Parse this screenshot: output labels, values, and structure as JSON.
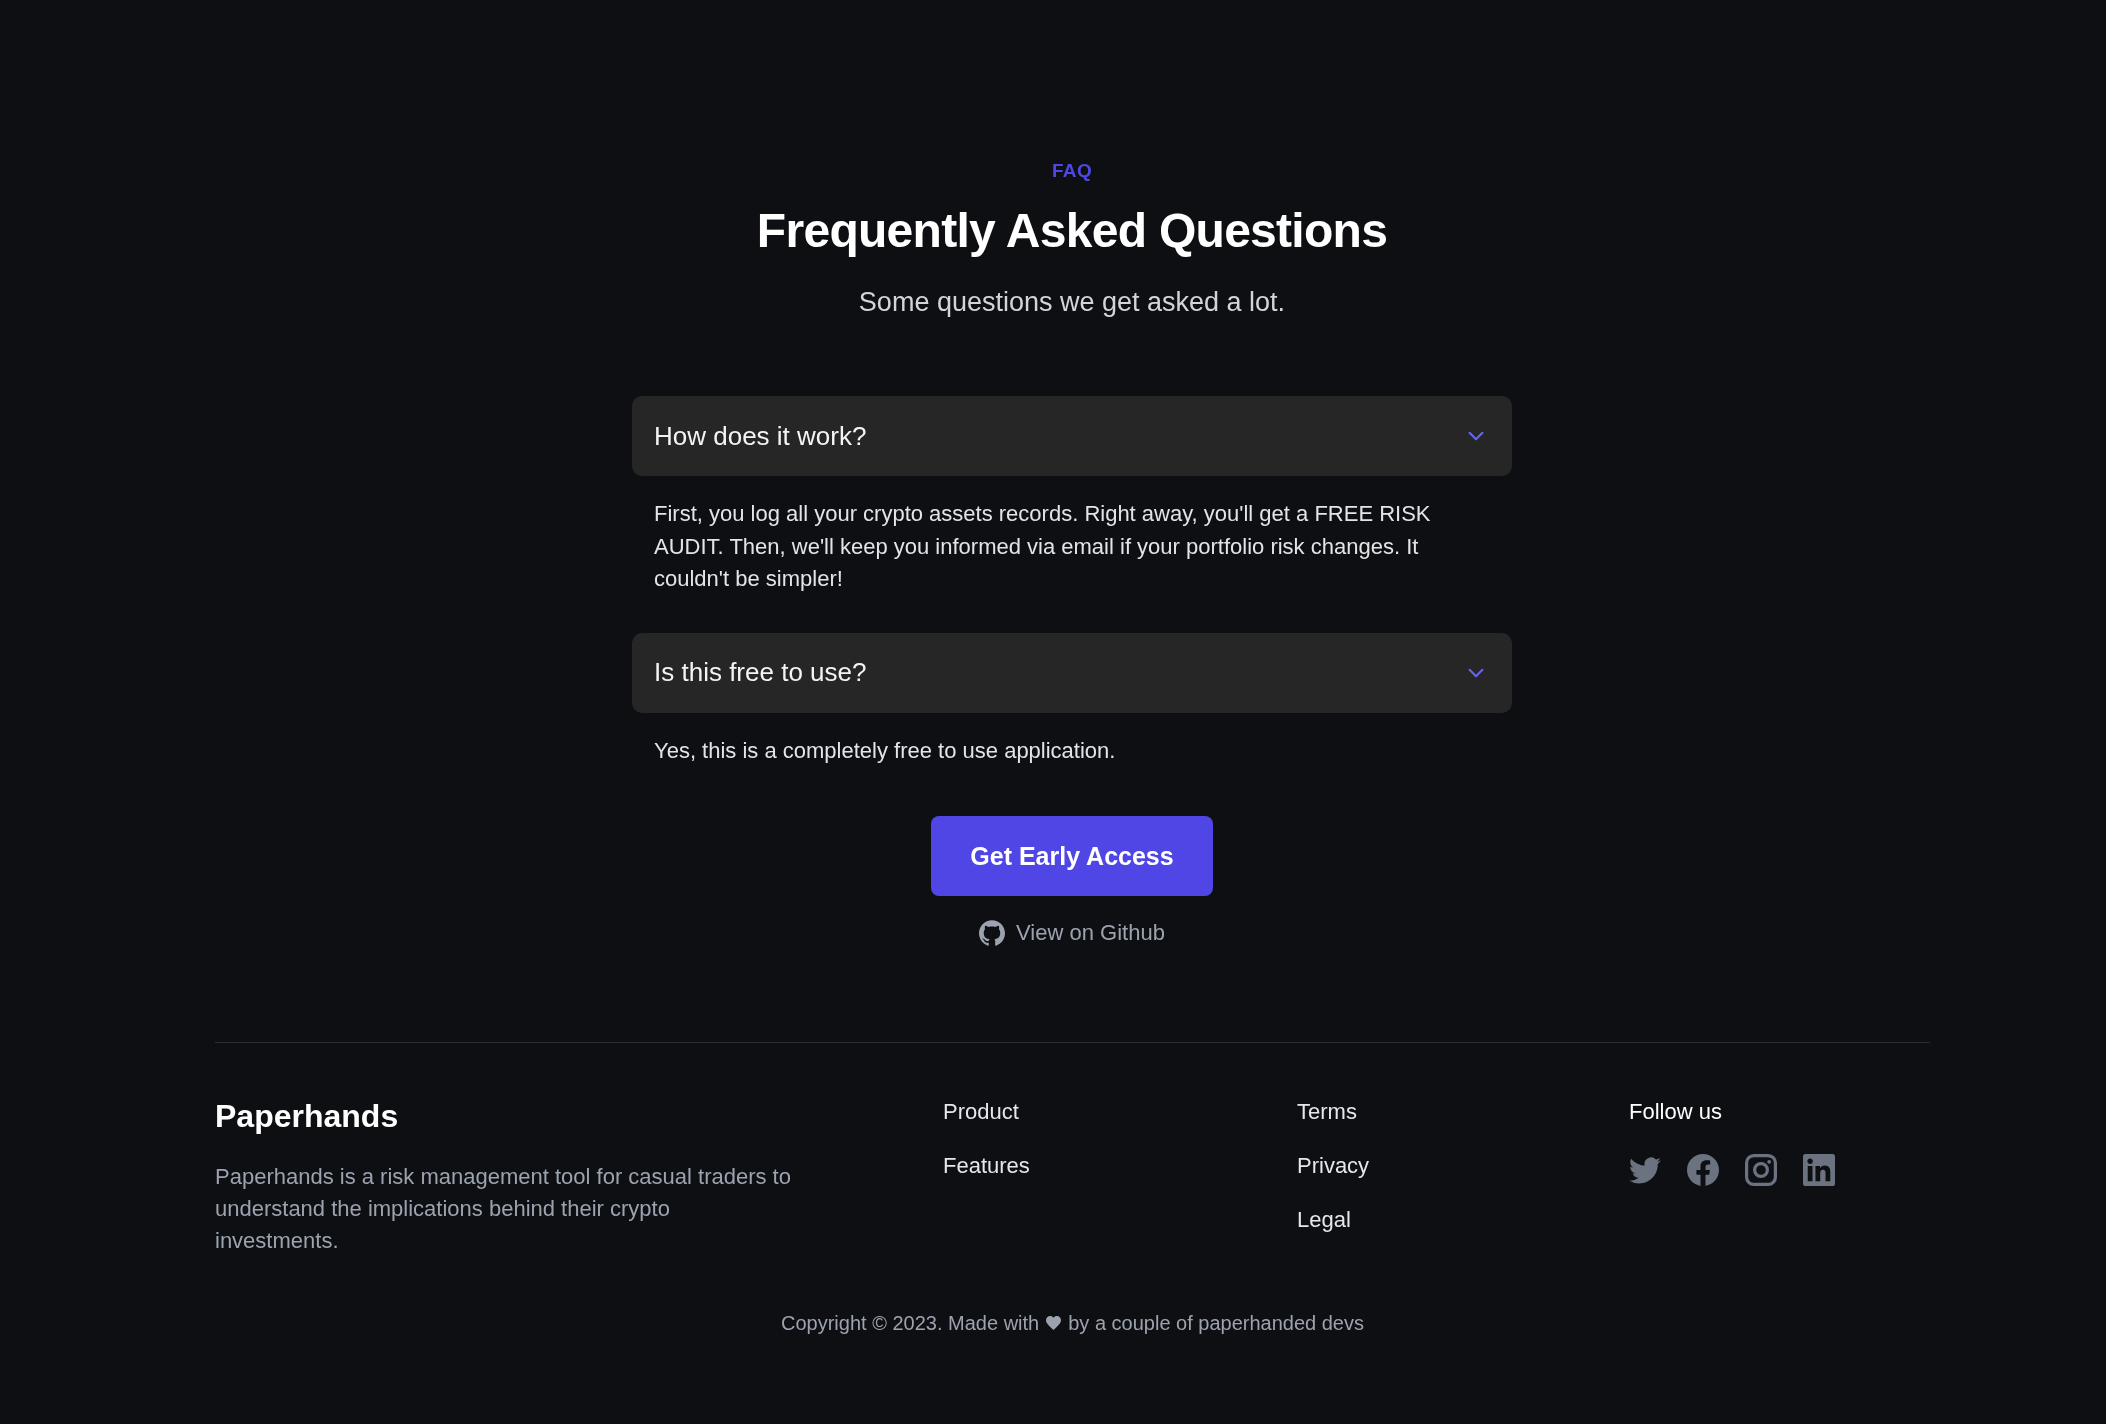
{
  "faq": {
    "eyebrow": "FAQ",
    "title": "Frequently Asked Questions",
    "subtitle": "Some questions we get asked a lot.",
    "items": [
      {
        "question": "How does it work?",
        "expanded": true,
        "answer": "First, you log all your crypto assets records. Right away, you'll get a FREE RISK AUDIT. Then, we'll keep you informed via email if your portfolio risk changes. It couldn't be simpler!"
      },
      {
        "question": "Is this free to use?",
        "expanded": true,
        "answer": "Yes, this is a completely free to use application."
      }
    ]
  },
  "cta": {
    "button": "Get Early Access",
    "github_link": "View on Github"
  },
  "footer": {
    "brand": "Paperhands",
    "description": "Paperhands is a risk management tool for casual traders to understand the implications behind their crypto investments.",
    "link_columns": [
      [
        "Product",
        "Features"
      ],
      [
        "Terms",
        "Privacy",
        "Legal"
      ]
    ],
    "social_title": "Follow us",
    "copyright": {
      "before": "Copyright © 2023. Made with",
      "after": "by a couple of paperhanded devs"
    }
  }
}
